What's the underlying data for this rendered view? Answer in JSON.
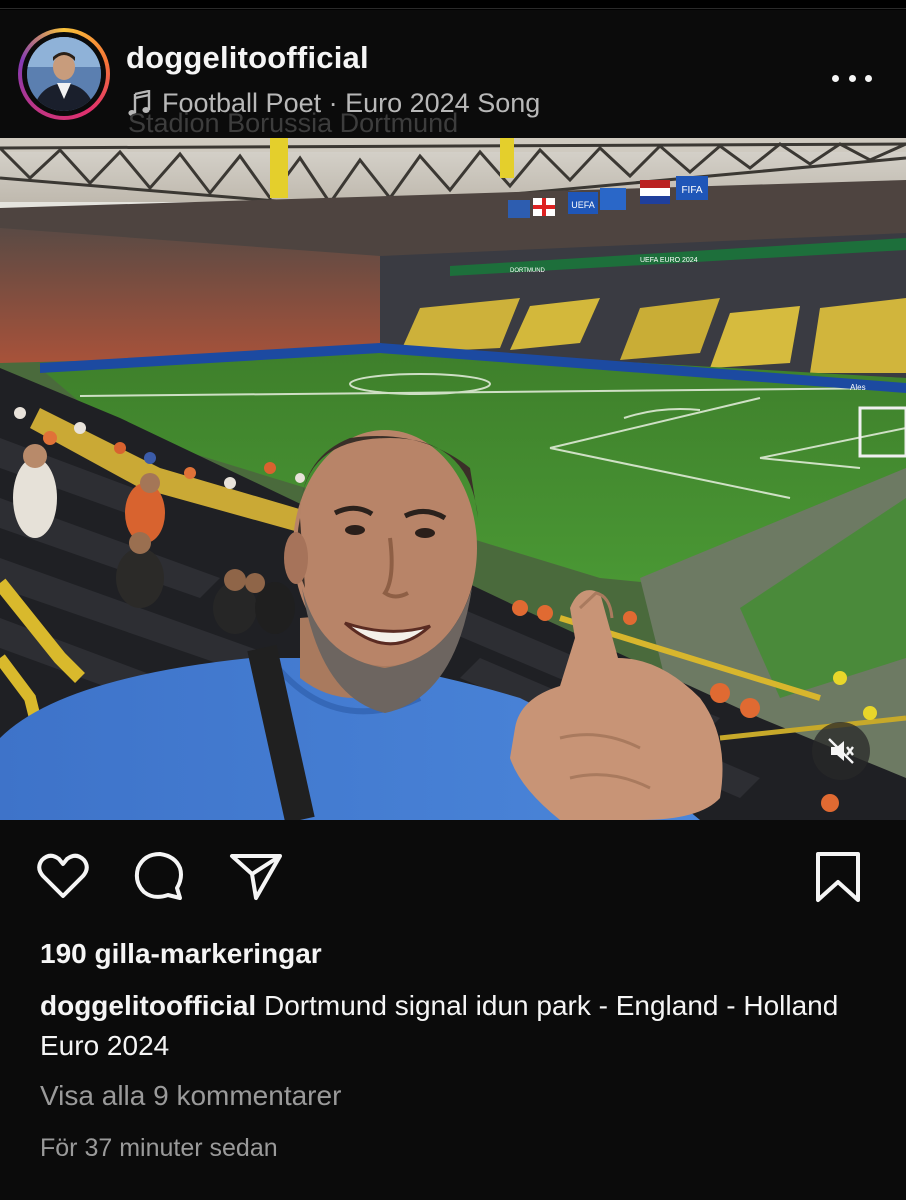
{
  "post": {
    "username": "doggelitoofficial",
    "song": "Football Poet · Euro 2024 Song",
    "location": "Stadion Borussia Dortmund",
    "photo_alt": "Selfie at the stadium",
    "likes": "190 gilla-markeringar",
    "caption_user": "doggelitoofficial",
    "caption_text": "Dortmund signal idun park - England - Holland Euro 2024",
    "view_comments": "Visa alla 9 kommentarer",
    "timestamp": "För 37 minuter sedan"
  },
  "photo_overlays": {
    "board_uefa": "UEFA",
    "board_fifa": "FIFA",
    "board_euro": "UEFA EURO 2024",
    "board_dortmund": "DORTMUND",
    "board_ad": "Ales"
  },
  "icons": {
    "more": "more-horizontal-icon",
    "note": "music-note-icon",
    "like": "heart-icon",
    "comment": "comment-bubble-icon",
    "share": "paper-plane-icon",
    "save": "bookmark-icon",
    "mute": "speaker-muted-icon"
  },
  "colors": {
    "background": "#0b0b0b",
    "text": "#f5f5f5",
    "muted": "#9a9a9a",
    "pitch": "#3f8a2c",
    "stand_yellow": "#d8b630"
  }
}
